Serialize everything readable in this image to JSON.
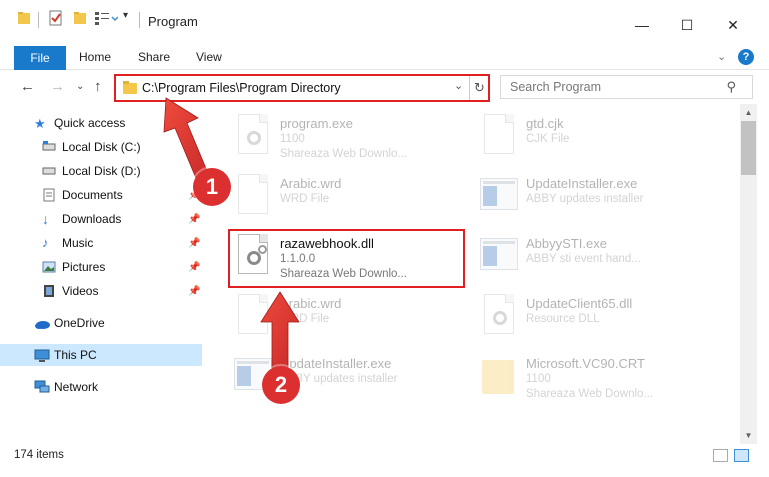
{
  "window": {
    "title": "Program",
    "minimize": "—",
    "maximize": "☐",
    "close": "✕"
  },
  "ribbon": {
    "file_tab": "File",
    "tabs": [
      "Home",
      "Share",
      "View"
    ]
  },
  "address_bar": {
    "path": "C:\\Program Files\\Program Directory",
    "dropdown": "⌄",
    "refresh": "↻"
  },
  "search": {
    "placeholder": "Search Program"
  },
  "sidebar": {
    "items": [
      {
        "label": "Quick access"
      },
      {
        "label": "Local Disk (C:)"
      },
      {
        "label": "Local Disk (D:)"
      },
      {
        "label": "Documents"
      },
      {
        "label": "Downloads"
      },
      {
        "label": "Music"
      },
      {
        "label": "Pictures"
      },
      {
        "label": "Videos"
      },
      {
        "label": "OneDrive"
      },
      {
        "label": "This PC"
      },
      {
        "label": "Network"
      }
    ]
  },
  "files": [
    {
      "name": "program.exe",
      "line2": "1100",
      "line3": "Shareaza Web Downlo..."
    },
    {
      "name": "gtd.cjk",
      "line2": "CJK File",
      "line3": ""
    },
    {
      "name": "Arabic.wrd",
      "line2": "WRD File",
      "line3": ""
    },
    {
      "name": "UpdateInstaller.exe",
      "line2": "ABBY updates installer",
      "line3": ""
    },
    {
      "name": "razawebhook.dll",
      "line2": "1.1.0.0",
      "line3": "Shareaza Web Downlo..."
    },
    {
      "name": "AbbyySTI.exe",
      "line2": "ABBY sti event hand...",
      "line3": ""
    },
    {
      "name": "Arabic.wrd",
      "line2": "WRD File",
      "line3": ""
    },
    {
      "name": "UpdateClient65.dll",
      "line2": "Resource DLL",
      "line3": ""
    },
    {
      "name": "UpdateInstaller.exe",
      "line2": "ABBY updates installer",
      "line3": ""
    },
    {
      "name": "Microsoft.VC90.CRT",
      "line2": "1100",
      "line3": "Shareaza Web Downlo..."
    }
  ],
  "status": {
    "item_count": "174 items"
  },
  "markers": [
    "1",
    "2"
  ],
  "colors": {
    "accent": "#1979ca",
    "highlight": "#e02020",
    "marker": "#dc2f2f",
    "selected_nav": "#cce8ff"
  }
}
